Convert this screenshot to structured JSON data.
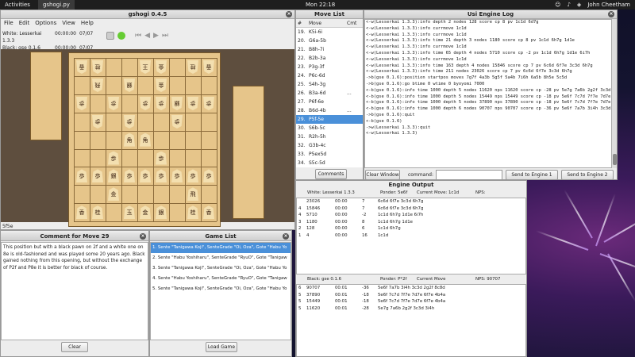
{
  "topbar": {
    "activities": "Activities",
    "app": "gshogi.py",
    "clock": "Mon 22:18",
    "user": "John Cheetham"
  },
  "main": {
    "title": "gshogi 0.4.5",
    "menu": [
      "File",
      "Edit",
      "Options",
      "View",
      "Help"
    ],
    "white_player": "White: Lesserkai 1.3.3",
    "white_time": "00:00:00",
    "white_moves": "07/07",
    "black_player": "Black:  gse 0.1.6",
    "black_time": "00:00:00",
    "black_moves": "07/07",
    "status": "5f5e"
  },
  "board": {
    "rows": [
      [
        {
          "k": "香",
          "g": true
        },
        {
          "k": "桂",
          "g": true
        },
        {
          "k": "",
          "g": true
        },
        {
          "k": "",
          "g": true
        },
        {
          "k": "王",
          "g": true
        },
        {
          "k": "金",
          "g": true
        },
        {
          "k": "",
          "g": true
        },
        {
          "k": "桂",
          "g": true
        },
        {
          "k": "香",
          "g": true
        }
      ],
      [
        {
          "k": "",
          "g": true
        },
        {
          "k": "飛",
          "g": true
        },
        {
          "k": "",
          "g": true
        },
        {
          "k": "銀",
          "g": true
        },
        {
          "k": "",
          "g": true
        },
        {
          "k": "金",
          "g": true
        },
        {
          "k": "",
          "g": true
        },
        {
          "k": "",
          "g": true
        },
        {
          "k": "",
          "g": true
        }
      ],
      [
        {
          "k": "歩",
          "g": true
        },
        {
          "k": "",
          "g": true
        },
        {
          "k": "歩",
          "g": true
        },
        {
          "k": "",
          "g": true
        },
        {
          "k": "歩",
          "g": true
        },
        {
          "k": "歩",
          "g": true
        },
        {
          "k": "銀",
          "g": true
        },
        {
          "k": "歩",
          "g": true
        },
        {
          "k": "歩",
          "g": true
        }
      ],
      [
        {
          "k": "",
          "g": true
        },
        {
          "k": "歩",
          "g": true
        },
        {
          "k": "",
          "g": true
        },
        {
          "k": "歩",
          "g": true
        },
        {
          "k": "",
          "g": true
        },
        {
          "k": "",
          "g": true
        },
        {
          "k": "歩",
          "g": true
        },
        {
          "k": "",
          "g": true
        },
        {
          "k": "",
          "g": true
        }
      ],
      [
        {
          "k": "",
          "g": false
        },
        {
          "k": "",
          "g": false
        },
        {
          "k": "",
          "g": false
        },
        {
          "k": "角",
          "g": false
        },
        {
          "k": "角",
          "g": false
        },
        {
          "k": "",
          "g": false
        },
        {
          "k": "",
          "g": false
        },
        {
          "k": "",
          "g": false
        },
        {
          "k": "",
          "g": false
        }
      ],
      [
        {
          "k": "",
          "g": false
        },
        {
          "k": "",
          "g": false
        },
        {
          "k": "歩",
          "g": false
        },
        {
          "k": "",
          "g": false
        },
        {
          "k": "",
          "g": false
        },
        {
          "k": "歩",
          "g": false
        },
        {
          "k": "",
          "g": false
        },
        {
          "k": "",
          "g": false
        },
        {
          "k": "",
          "g": false
        }
      ],
      [
        {
          "k": "歩",
          "g": false
        },
        {
          "k": "歩",
          "g": false
        },
        {
          "k": "銀",
          "g": false
        },
        {
          "k": "歩",
          "g": false
        },
        {
          "k": "歩",
          "g": false
        },
        {
          "k": "歩",
          "g": false
        },
        {
          "k": "歩",
          "g": false
        },
        {
          "k": "歩",
          "g": false
        },
        {
          "k": "歩",
          "g": false
        }
      ],
      [
        {
          "k": "",
          "g": false
        },
        {
          "k": "",
          "g": false
        },
        {
          "k": "金",
          "g": false
        },
        {
          "k": "",
          "g": false
        },
        {
          "k": "",
          "g": false
        },
        {
          "k": "",
          "g": false
        },
        {
          "k": "",
          "g": false
        },
        {
          "k": "飛",
          "g": false
        },
        {
          "k": "",
          "g": false
        }
      ],
      [
        {
          "k": "香",
          "g": false
        },
        {
          "k": "桂",
          "g": false
        },
        {
          "k": "",
          "g": false
        },
        {
          "k": "玉",
          "g": false
        },
        {
          "k": "金",
          "g": false
        },
        {
          "k": "銀",
          "g": false
        },
        {
          "k": "",
          "g": false
        },
        {
          "k": "桂",
          "g": false
        },
        {
          "k": "香",
          "g": false
        }
      ]
    ]
  },
  "move_list": {
    "title": "Move List",
    "headers": [
      "#",
      "Move",
      "Cmt"
    ],
    "rows": [
      {
        "n": "19.",
        "m": "K5i-6i",
        "c": ""
      },
      {
        "n": "20.",
        "m": "G6a-5b",
        "c": ""
      },
      {
        "n": "21.",
        "m": "B8h-7i",
        "c": ""
      },
      {
        "n": "22.",
        "m": "B2b-3a",
        "c": ""
      },
      {
        "n": "23.",
        "m": "P3g-3f",
        "c": ""
      },
      {
        "n": "24.",
        "m": "P6c-6d",
        "c": ""
      },
      {
        "n": "25.",
        "m": "S4h-3g",
        "c": ""
      },
      {
        "n": "26.",
        "m": "B3a-6d",
        "c": "..."
      },
      {
        "n": "27.",
        "m": "P6f-6e",
        "c": ""
      },
      {
        "n": "28.",
        "m": "B6d-4b",
        "c": "..."
      },
      {
        "n": "29.",
        "m": "P5f-5e",
        "c": ""
      },
      {
        "n": "30.",
        "m": "S6b-5c",
        "c": ""
      },
      {
        "n": "31.",
        "m": "R2h-5h",
        "c": ""
      },
      {
        "n": "32.",
        "m": "G3b-4c",
        "c": ""
      },
      {
        "n": "33.",
        "m": "P5ex5d",
        "c": ""
      },
      {
        "n": "34.",
        "m": "S5c-5d",
        "c": ""
      }
    ],
    "selected": 10,
    "comments_btn": "Comments"
  },
  "usi_log": {
    "title": "Usi Engine Log",
    "lines": [
      "<-w(Lesserkai 1.3.3):info depth 2 nodes 128 score cp 8 pv 1c1d 6d7g",
      "<-w(Lesserkai 1.3.3):info currmove 1c1d",
      "<-w(Lesserkai 1.3.3):info currmove 1c1d",
      "<-w(Lesserkai 1.3.3):info time 21 depth 3 nodes 1180 score cp 8 pv 1c1d 6h7g 1d1e",
      "<-w(Lesserkai 1.3.3):info currmove 1c1d",
      "<-w(Lesserkai 1.3.3):info time 65 depth 4 nodes 5710 score cp -2 pv 1c1d 6h7g 1d1e 6i7h",
      "<-w(Lesserkai 1.3.3):info currmove 1c1d",
      "<-w(Lesserkai 1.3.3):info time 163 depth 4 nodes 15846 score cp 7 pv 6c6d 6f7e 3c3d 6h7g",
      "<-w(Lesserkai 1.3.3):info time 211 nodes 23026 score cp 7 pv 6c6d 6f7e 3c3d 6h7g",
      "->b(gse 0.1.6):position startpos moves 7g7f 4a3b 5g5f 5a4b 7i6h 6a5b 8h5e 5c5d",
      "->b(gse 0.1.6):go btime 0 wtime 0 byoyomi 7000",
      "<-b(gse 0.1.6):info time 1000 depth 5 nodes 11620 nps 11620 score cp -28 pv 5e7g 7a6b 2g2f 3c3d 3i4h",
      "<-b(gse 0.1.6):info time 1000 depth 5 nodes 15449 nps 15449 score cp -18 pv 5e6f 7c7d 7f7e 7d7e 6f7e 4b4a",
      "<-b(gse 0.1.6):info time 1000 depth 5 nodes 37890 nps 37890 score cp -18 pv 5e6f 7c7d 7f7e 7d7e 6f7e 4b4a",
      "<-b(gse 0.1.6):info time 1000 depth 6 nodes 90707 nps 90707 score cp -36 pv 5e6f 7a7b 3i4h 3c3d 2g2f 8c8d",
      "->b(gse 0.1.6):quit",
      "<-b(gse 0.1.6)",
      "->w(Lesserkai 1.3.3):quit",
      "<-w(Lesserkai 1.3.3)"
    ],
    "clear_btn": "Clear Window",
    "command_label": "command:",
    "command_value": "",
    "send1": "Send to Engine 1",
    "send2": "Send to Engine 2"
  },
  "engine_output": {
    "title": "Engine Output",
    "w_header": {
      "name": "White: Lesserkai 1.3.3",
      "ponder": "Ponder: 5e6f",
      "move": "Current Move: 1c1d",
      "nps": "NPS:"
    },
    "w_rows": [
      [
        "",
        "23026",
        "00:00",
        "7",
        "6c6d 6f7e 3c3d 6h7g"
      ],
      [
        "4",
        "15846",
        "00:00",
        "7",
        "6c6d 6f7e 3c3d 6h7g"
      ],
      [
        "4",
        "5710",
        "00:00",
        "-2",
        "1c1d 6h7g 1d1e 6i7h"
      ],
      [
        "3",
        "1180",
        "00:00",
        "8",
        "1c1d 6h7g 1d1e"
      ],
      [
        "2",
        "128",
        "00:00",
        "6",
        "1c1d 6h7g"
      ],
      [
        "1",
        "4",
        "00:00",
        "16",
        "1c1d"
      ]
    ],
    "b_header": {
      "name": "Black: gse 0.1.6",
      "ponder": "Ponder: P*2f",
      "move": "Current Move",
      "nps": "NPS: 90707"
    },
    "b_rows": [
      [
        "6",
        "90707",
        "00:01",
        "-36",
        "5e6f 7a7b 3i4h 3c3d 2g2f 8c8d"
      ],
      [
        "5",
        "37890",
        "00:01",
        "-18",
        "5e6f 7c7d 7f7e 7d7e 6f7e 4b4a"
      ],
      [
        "5",
        "15449",
        "00:01",
        "-18",
        "5e6f 7c7d 7f7e 7d7e 6f7e 4b4a"
      ],
      [
        "5",
        "11620",
        "00:01",
        "-28",
        "5e7g 7a6b 2g2f 3c3d 3i4h"
      ]
    ]
  },
  "comment": {
    "title": "Comment for Move 29",
    "text": "This position but with a black pawn on 2f and a white one on 8e is old-fashioned and was played some 20 years ago. Black gained nothing from this opening, but without the exchange of P2f and P8e it is better for black of course.",
    "clear_btn": "Clear"
  },
  "game_list": {
    "title": "Game List",
    "items": [
      "1. Sente \"Tanigawa Koji\", SenteGrade \"Oi, Oza\", Gote \"Habu Yo",
      "2. Sente \"Habu Yoshiharu\", SenteGrade \"RyuO\", Gote \"Tanigaw",
      "3. Sente \"Tanigawa Koji\", SenteGrade \"Oi, Oza\", Gote \"Habu Yo",
      "4. Sente \"Habu Yoshiharu\", SenteGrade \"RyuO\", Gote \"Tanigaw",
      "5. Sente \"Tanigawa Koji\", SenteGrade \"Oi, Oza\", Gote \"Habu Yo"
    ],
    "load_btn": "Load Game"
  }
}
